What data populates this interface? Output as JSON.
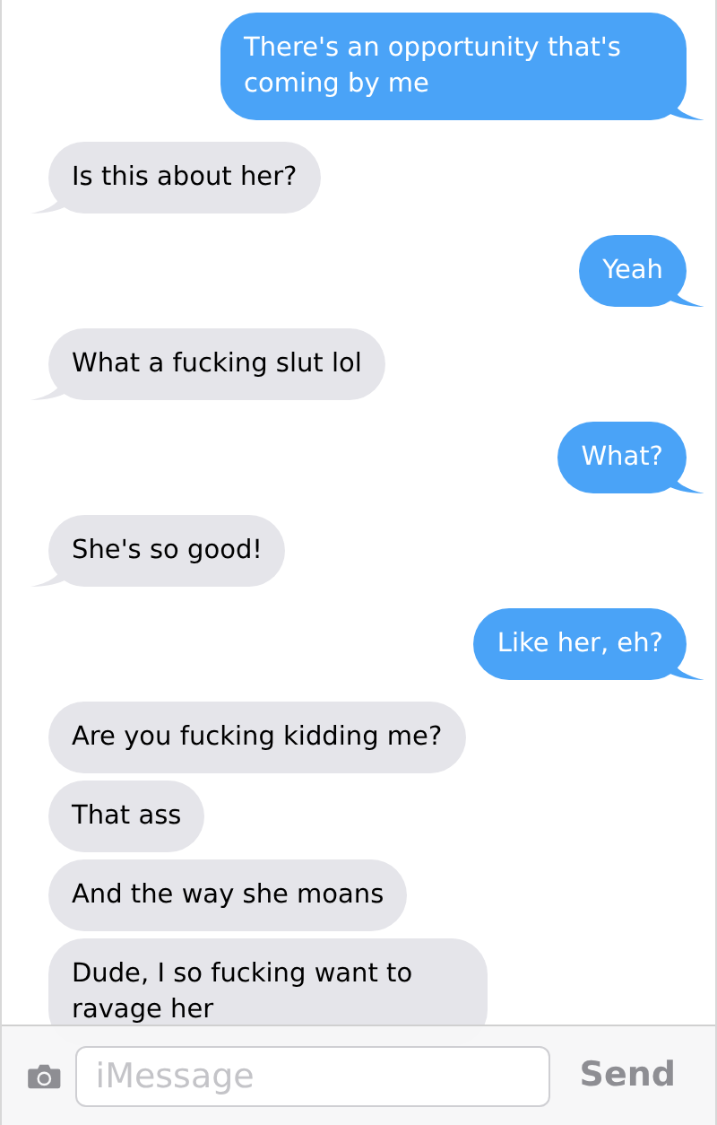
{
  "messages": [
    {
      "kind": "sent",
      "text": "There's an opportunity that's coming by me",
      "tail": true
    },
    {
      "kind": "received",
      "text": "Is this about her?",
      "tail": true
    },
    {
      "kind": "sent",
      "text": "Yeah",
      "tail": true
    },
    {
      "kind": "received",
      "text": "What a fucking slut lol",
      "tail": true
    },
    {
      "kind": "sent",
      "text": "What?",
      "tail": true
    },
    {
      "kind": "received",
      "text": "She's so good!",
      "tail": true
    },
    {
      "kind": "sent",
      "text": "Like her, eh?",
      "tail": true
    },
    {
      "kind": "received",
      "text": "Are you fucking kidding me?",
      "tail": false
    },
    {
      "kind": "received",
      "text": "That ass",
      "tail": false
    },
    {
      "kind": "received",
      "text": "And the way she moans",
      "tail": false
    },
    {
      "kind": "received",
      "text": "Dude, I so fucking want to ravage her"
    }
  ],
  "composer": {
    "placeholder": "iMessage",
    "send": "Send"
  }
}
